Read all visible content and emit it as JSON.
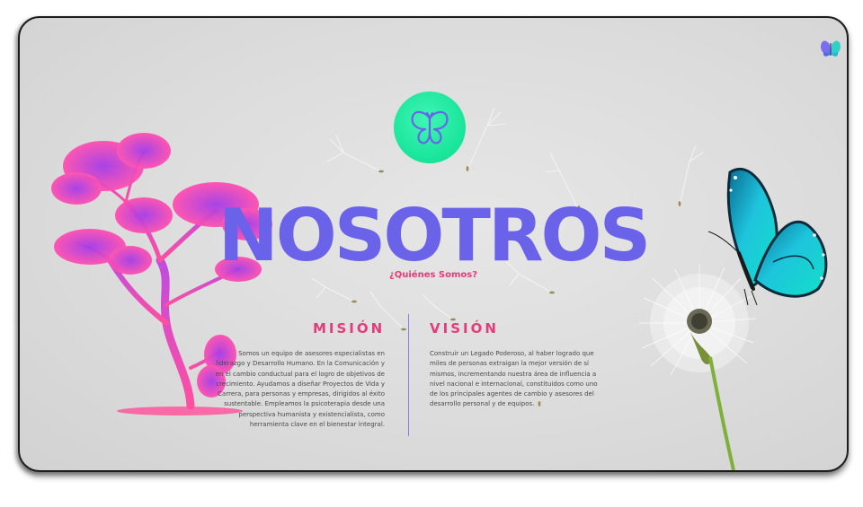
{
  "hero": {
    "title": "NOSOTROS",
    "subtitle": "¿Quiénes Somos?"
  },
  "mision": {
    "heading": "MISIÓN",
    "text": "Somos un equipo de asesores especialistas en liderazgo y Desarrollo Humano. En la Comunicación y en el cambio conductual para el logro de objetivos de crecimiento. Ayudamos a diseñar Proyectos de Vida y Carrera, para personas y empresas, dirigidos al éxito sustentable. Empleamos la psicoterapia desde una perspectiva humanista y existencialista, como herramienta clave en el bienestar integral."
  },
  "vision": {
    "heading": "VISIÓN",
    "text": "Construir un Legado Poderoso, al haber logrado que miles de personas extraigan la mejor versión de sí mismos, incrementando nuestra área de influencia a nivel nacional e internacional, constituidos como uno de los principales agentes de cambio y asesores del desarrollo personal y de equipos."
  },
  "icons": {
    "logo": "butterfly-icon",
    "corner_logo": "butterfly-icon"
  },
  "colors": {
    "title": "#6b62ea",
    "accent": "#e53b7a",
    "logo_bg": "#18e49a",
    "background": "#dcdcdc"
  }
}
